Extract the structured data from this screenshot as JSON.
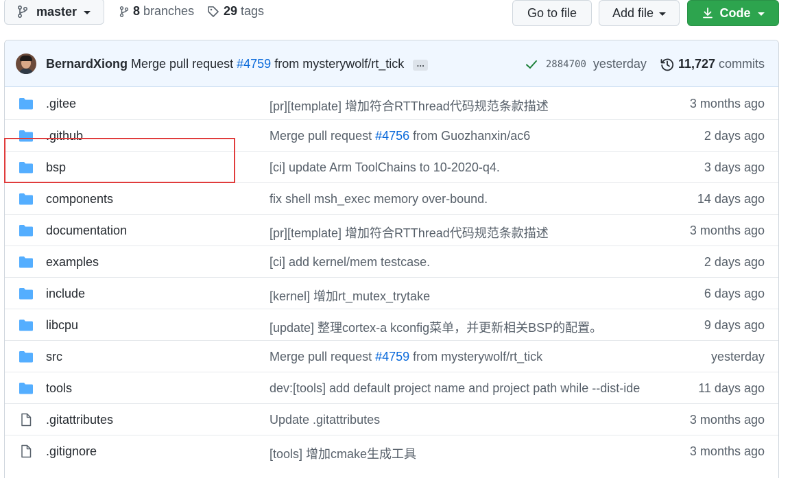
{
  "toolbar": {
    "branch": "master",
    "branches_count": "8",
    "branches_label": "branches",
    "tags_count": "29",
    "tags_label": "tags",
    "go_to_file": "Go to file",
    "add_file": "Add file",
    "code": "Code"
  },
  "commit": {
    "author": "BernardXiong",
    "message_prefix": "Merge pull request",
    "pr_link": "#4759",
    "message_suffix": "from mysterywolf/rt_tick",
    "ellipsis": "…",
    "sha": "2884700",
    "time": "yesterday",
    "commits_count": "11,727",
    "commits_label": "commits"
  },
  "files": [
    {
      "type": "folder",
      "name": ".gitee",
      "msg": "[pr][template] 增加符合RTThread代码规范条款描述",
      "age": "3 months ago"
    },
    {
      "type": "folder",
      "name": ".github",
      "msg_prefix": "Merge pull request ",
      "msg_link": "#4756",
      "msg_suffix": " from Guozhanxin/ac6",
      "age": "2 days ago"
    },
    {
      "type": "folder",
      "name": "bsp",
      "msg": "[ci] update Arm ToolChains to 10-2020-q4.",
      "age": "3 days ago"
    },
    {
      "type": "folder",
      "name": "components",
      "msg": "fix shell msh_exec memory over-bound.",
      "age": "14 days ago"
    },
    {
      "type": "folder",
      "name": "documentation",
      "msg": "[pr][template] 增加符合RTThread代码规范条款描述",
      "age": "3 months ago"
    },
    {
      "type": "folder",
      "name": "examples",
      "msg": "[ci] add kernel/mem testcase.",
      "age": "2 days ago"
    },
    {
      "type": "folder",
      "name": "include",
      "msg": "[kernel] 增加rt_mutex_trytake",
      "age": "6 days ago"
    },
    {
      "type": "folder",
      "name": "libcpu",
      "msg": "[update] 整理cortex-a kconfig菜单，并更新相关BSP的配置。",
      "age": "9 days ago"
    },
    {
      "type": "folder",
      "name": "src",
      "msg_prefix": "Merge pull request ",
      "msg_link": "#4759",
      "msg_suffix": " from mysterywolf/rt_tick",
      "age": "yesterday"
    },
    {
      "type": "folder",
      "name": "tools",
      "msg": "dev:[tools] add default project name and project path while --dist-ide",
      "age": "11 days ago"
    },
    {
      "type": "file",
      "name": ".gitattributes",
      "msg": "Update .gitattributes",
      "age": "3 months ago"
    },
    {
      "type": "file",
      "name": ".gitignore",
      "msg": "[tools] 增加cmake生成工具",
      "age": "3 months ago"
    }
  ],
  "colors": {
    "folder": "#54aeff",
    "link": "#0969da",
    "code_button": "#2da44e",
    "highlight": "#e03c3c"
  }
}
